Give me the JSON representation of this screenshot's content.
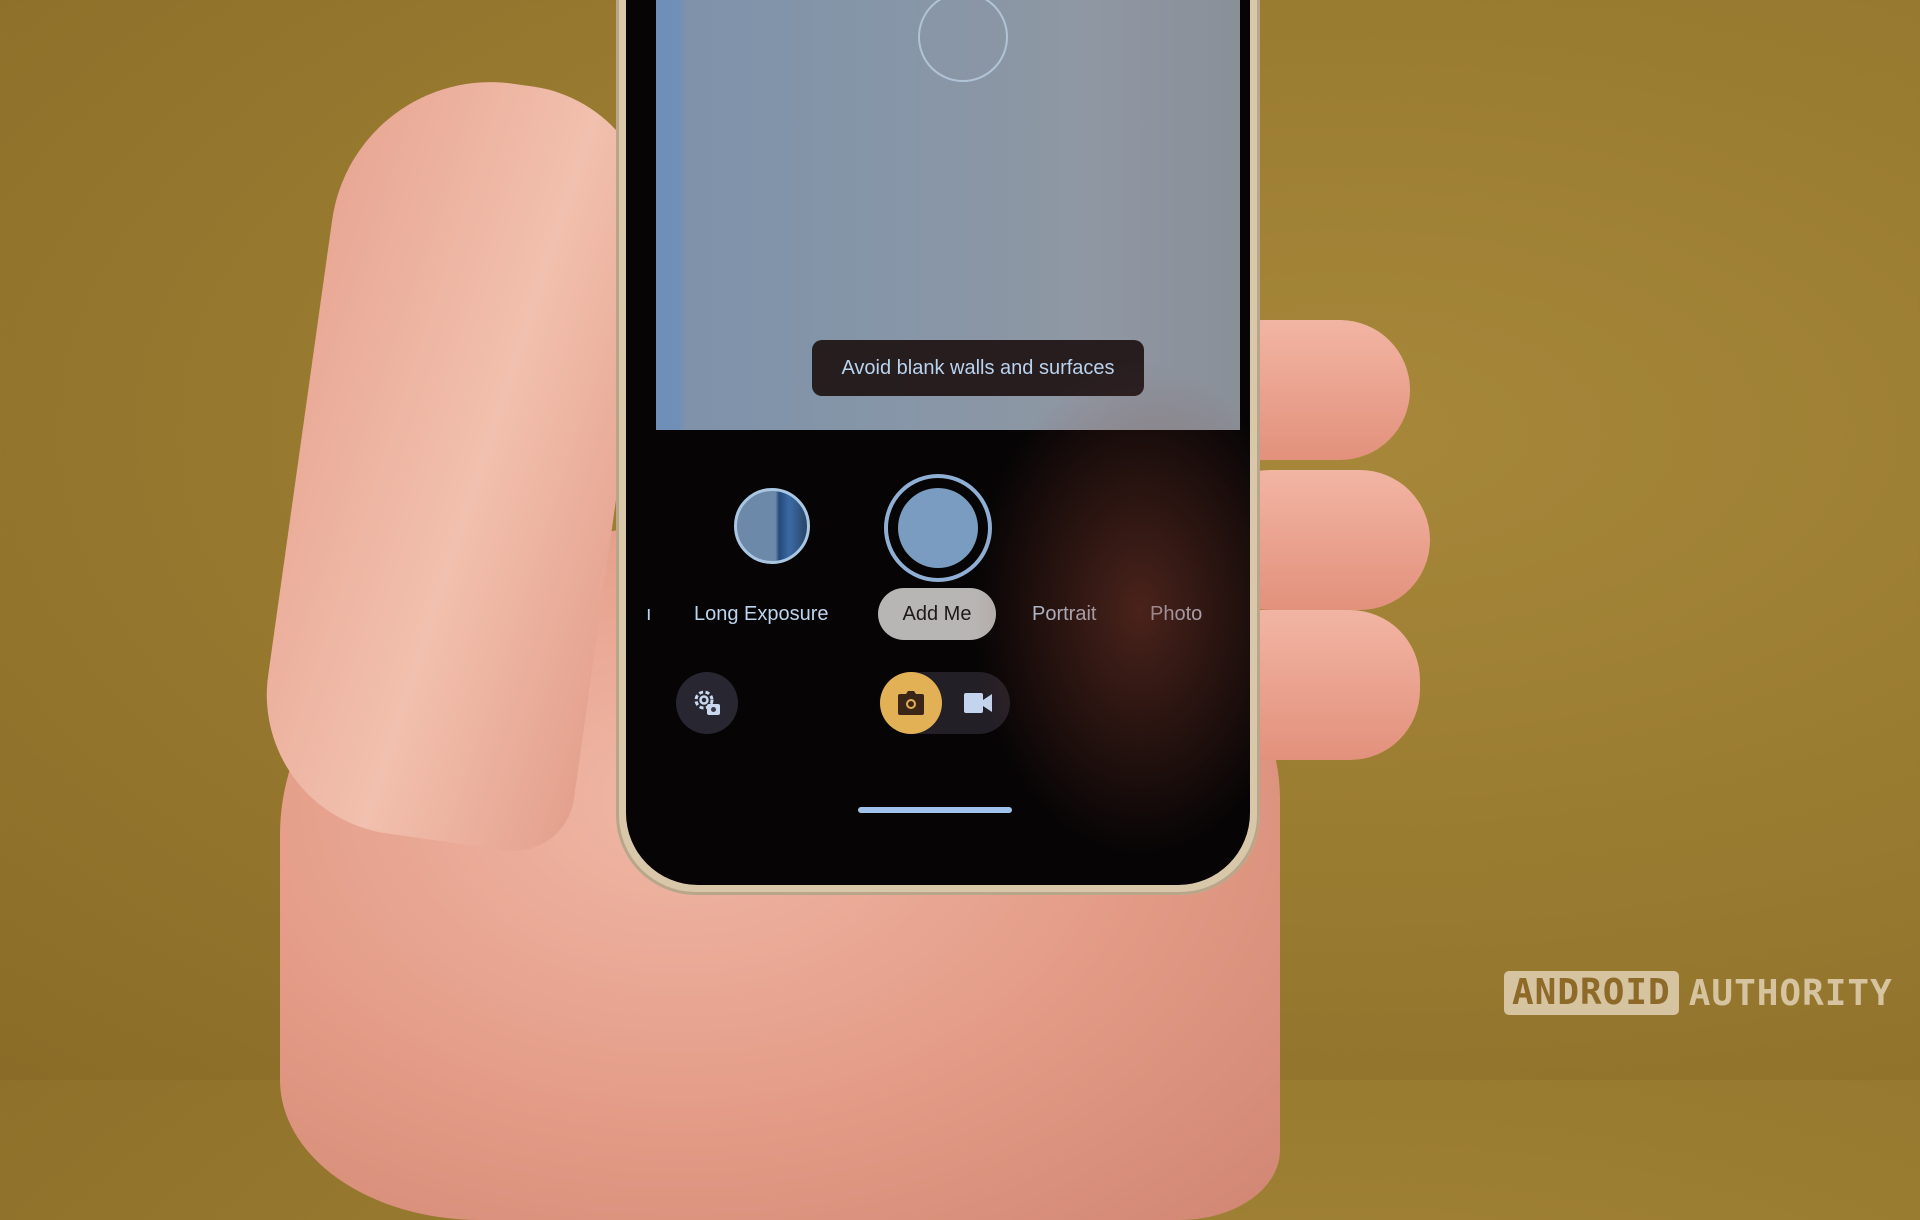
{
  "scene": {
    "description": "Hand holding a Pixel phone showing the camera app in Add Me mode",
    "background_color": "#9a7c31"
  },
  "camera_app": {
    "viewfinder": {
      "hint_text": "Avoid blank walls and surfaces",
      "focus_indicator": "focus-ring"
    },
    "controls": {
      "thumbnail_label": "Last photo",
      "shutter_label": "Shutter"
    },
    "modes": {
      "items": [
        {
          "label": "Long Exposure",
          "active": false
        },
        {
          "label": "Add Me",
          "active": true
        },
        {
          "label": "Portrait",
          "active": false
        },
        {
          "label": "Photo",
          "active": false
        }
      ],
      "selected": "Add Me"
    },
    "bottom_bar": {
      "settings_icon": "settings-camera-icon",
      "photo_icon": "camera-icon",
      "video_icon": "videocam-icon",
      "active_capture": "photo",
      "accent_color": "#e3b155"
    }
  },
  "watermark": {
    "brand_boxed": "ANDROID",
    "brand_text": "AUTHORITY"
  }
}
